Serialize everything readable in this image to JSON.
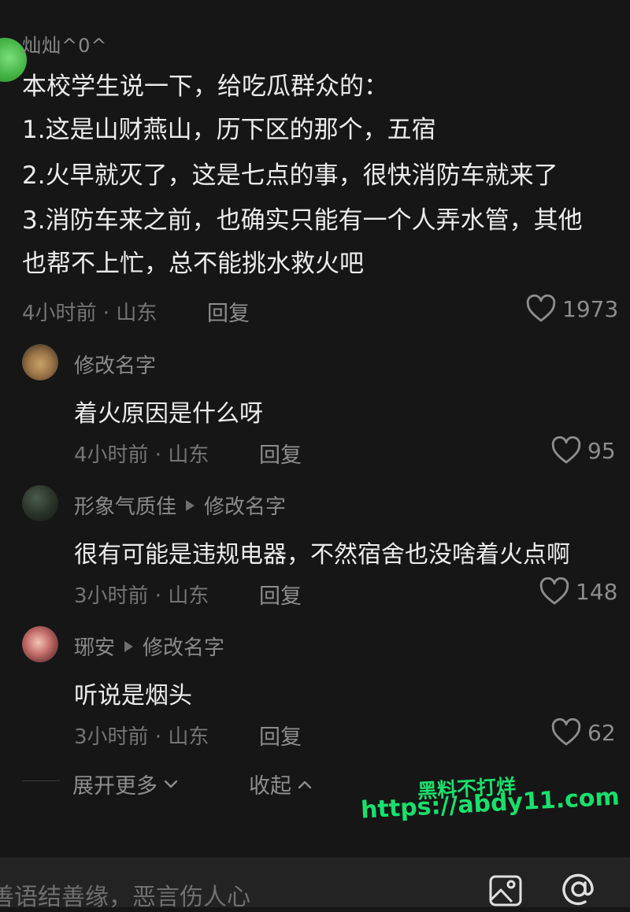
{
  "main_comment": {
    "username": "灿灿^0^",
    "lines": [
      "本校学生说一下，给吃瓜群众的：",
      "1.这是山财燕山，历下区的那个，五宿",
      "2.火早就灭了，这是七点的事，很快消防车就来了",
      "3.消防车来之前，也确实只能有一个人弄水管，其他",
      "也帮不上忙，总不能挑水救火吧"
    ],
    "meta": "4小时前 · 山东",
    "reply_label": "回复",
    "likes": "1973"
  },
  "replies": [
    {
      "username": "修改名字",
      "reply_to": "",
      "text": "着火原因是什么呀",
      "meta": "4小时前 · 山东",
      "reply_label": "回复",
      "likes": "95"
    },
    {
      "username": "形象气质佳",
      "reply_to": "修改名字",
      "text": "很有可能是违规电器，不然宿舍也没啥着火点啊",
      "meta": "3小时前 · 山东",
      "reply_label": "回复",
      "likes": "148"
    },
    {
      "username": "琊安",
      "reply_to": "修改名字",
      "text": "听说是烟头",
      "meta": "3小时前 · 山东",
      "reply_label": "回复",
      "likes": "62"
    }
  ],
  "thread_controls": {
    "expand_more": "展开更多",
    "collapse": "收起"
  },
  "watermark": {
    "line1": "黑料不打烊",
    "line2": "https://abdy11.com"
  },
  "input": {
    "placeholder": "善语结善缘，恶言伤人心"
  },
  "icons": {
    "image": "image-icon",
    "at": "at-icon",
    "heart": "heart-outline-icon"
  }
}
